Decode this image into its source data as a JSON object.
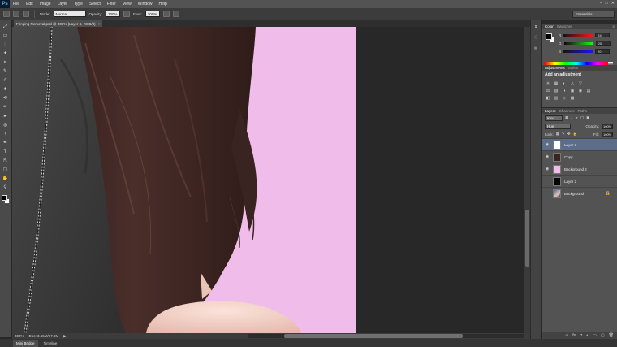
{
  "app": {
    "logo": "Ps"
  },
  "menu": [
    "File",
    "Edit",
    "Image",
    "Layer",
    "Type",
    "Select",
    "Filter",
    "View",
    "Window",
    "Help"
  ],
  "window_controls": [
    "–",
    "□",
    "✕"
  ],
  "options_bar": {
    "mode_label": "Mode:",
    "mode_value": "Normal",
    "opacity_label": "Opacity:",
    "opacity_value": "100%",
    "flow_label": "Flow:",
    "flow_value": "100%",
    "workspace": "Essentials"
  },
  "document": {
    "tab_title": "Fringing Removal.psd @ 300% (Layer 3, RGB/8)",
    "tab_close": "×"
  },
  "status": {
    "zoom": "300%",
    "doc_info": "Doc: 3.55M/17.9M",
    "arrow": "▶"
  },
  "bottom_tabs": [
    "Mini Bridge",
    "Timeline"
  ],
  "colors": {
    "canvas_pink": "#f0bdea",
    "hair": "#3a2421",
    "shirt": "#3d3c3c",
    "skin": "#f4d6cd",
    "selected_layer": "#5b6d89"
  },
  "color_panel": {
    "tabs": [
      "Color",
      "Swatches"
    ],
    "menu_icon": "≡",
    "r_label": "R",
    "r_value": "24",
    "g_label": "G",
    "g_value": "20",
    "b_label": "B",
    "b_value": "20"
  },
  "adjustments_panel": {
    "tabs": [
      "Adjustments",
      "Styles"
    ],
    "title": "Add an adjustment",
    "row1": [
      "☀",
      "▦",
      "◐",
      "◭",
      "▽"
    ],
    "row2": [
      "⚖",
      "▨",
      "◑",
      "▣",
      "◉",
      "▤"
    ],
    "row3": [
      "◧",
      "▥",
      "◇",
      "▩"
    ]
  },
  "layers_panel": {
    "tabs": [
      "Layers",
      "Channels",
      "Paths"
    ],
    "kind_label": "Kind",
    "blend_mode": "Hue",
    "opacity_label": "Opacity:",
    "opacity_value": "100%",
    "lock_label": "Lock:",
    "fill_label": "Fill:",
    "fill_value": "100%",
    "lock_icons": [
      "▦",
      "✎",
      "✥",
      "🔒"
    ],
    "layers": [
      {
        "name": "Layer 3",
        "selected": true,
        "thumb": "#ffffff",
        "visible": true
      },
      {
        "name": "Copy",
        "selected": false,
        "thumb": "#3a2421",
        "visible": true
      },
      {
        "name": "Background 2",
        "selected": false,
        "thumb": "#f0bdea",
        "visible": true
      },
      {
        "name": "Layer 2",
        "selected": false,
        "thumb": "#050505",
        "visible": false
      },
      {
        "name": "Background",
        "selected": false,
        "thumb": "#4a9ad0",
        "visible": false,
        "locked": true
      }
    ],
    "footer_icons": [
      "∞",
      "fx",
      "◘",
      "◐",
      "▭",
      "▢",
      "🗑"
    ]
  },
  "tools": [
    "⤢",
    "▭",
    "◌",
    "✦",
    "⌗",
    "✎",
    "✐",
    "♣",
    "⟲",
    "✏",
    "▰",
    "◍",
    "◑",
    "✒",
    "T",
    "⇱",
    "▢",
    "✋",
    "⚲"
  ]
}
